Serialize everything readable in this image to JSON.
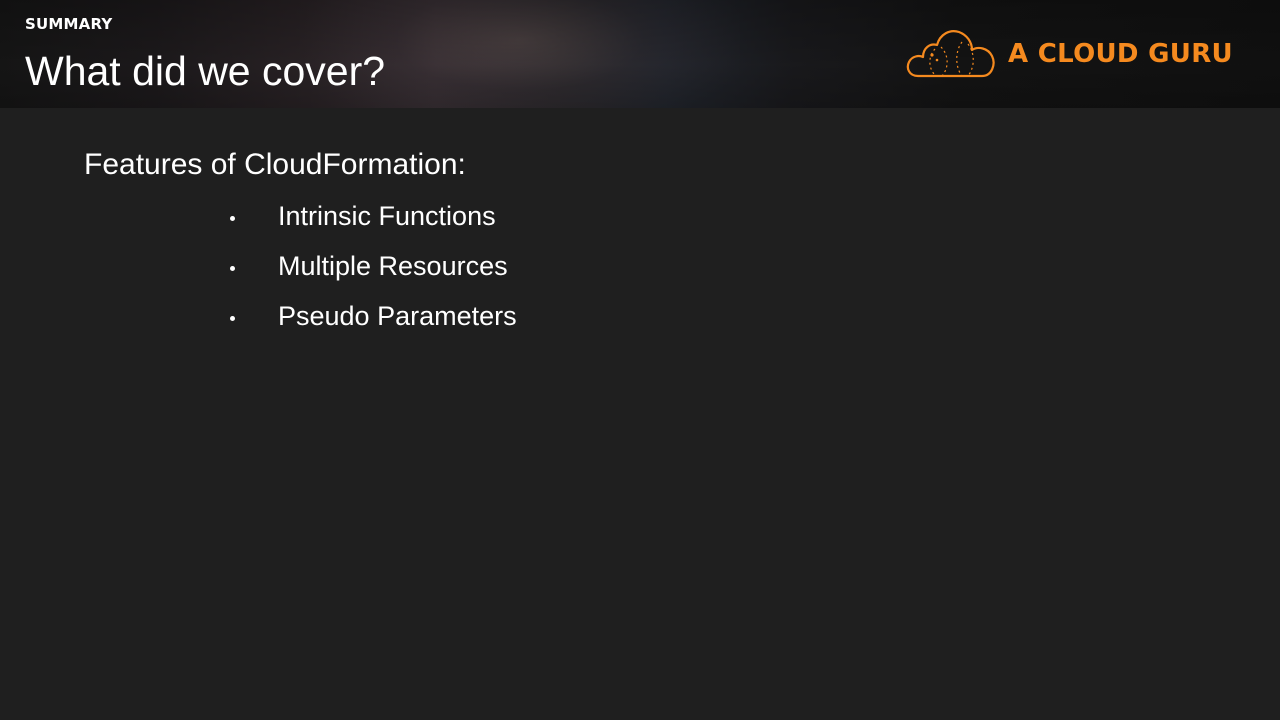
{
  "header": {
    "section_label": "SUMMARY",
    "title": "What did we cover?"
  },
  "brand": {
    "name": "A CLOUD GURU",
    "logo_icon": "cloud-logo-icon",
    "accent_color": "#f58a1f"
  },
  "content": {
    "heading": "Features of CloudFormation:",
    "bullets": [
      "Intrinsic Functions",
      "Multiple Resources",
      "Pseudo Parameters"
    ]
  },
  "colors": {
    "background": "#1f1f1f",
    "text": "#ffffff"
  }
}
